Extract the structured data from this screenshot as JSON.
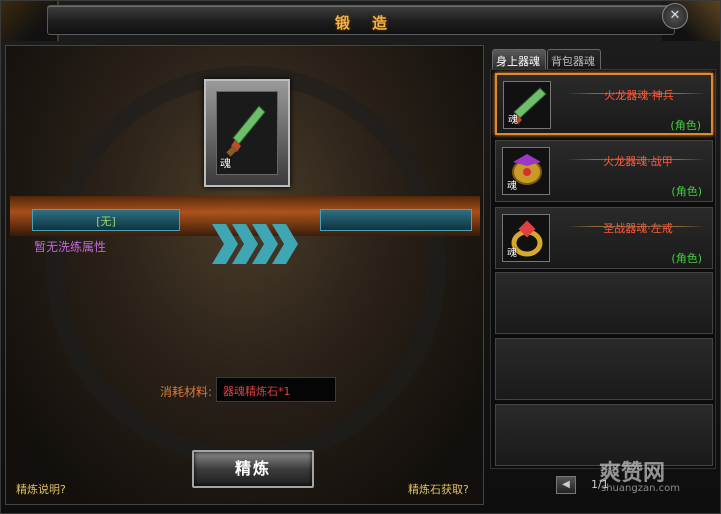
{
  "window": {
    "title": "锻造",
    "close_icon": "close-icon"
  },
  "forge": {
    "item_soul_tag": "魂",
    "left_bar_label": "[无]",
    "right_bar_label": "",
    "no_attribute_text": "暂无洗练属性",
    "material_label": "消耗材料:",
    "material_value": "器魂精炼石*1",
    "refine_button": "精炼",
    "help_link": "精炼说明?",
    "stone_source_link": "精炼石获取?"
  },
  "tabs": [
    {
      "label": "身上器魂",
      "active": true
    },
    {
      "label": "背包器魂",
      "active": false
    }
  ],
  "slots": [
    {
      "name": "火龙器魂·神兵",
      "tag": "(角色)",
      "soul": "魂",
      "icon": "sword-icon",
      "selected": true
    },
    {
      "name": "火龙器魂·战甲",
      "tag": "(角色)",
      "soul": "魂",
      "icon": "helmet-icon",
      "selected": false
    },
    {
      "name": "圣战器魂·左戒",
      "tag": "(角色)",
      "soul": "魂",
      "icon": "ring-icon",
      "selected": false
    },
    {
      "name": "",
      "tag": "",
      "soul": "",
      "icon": "",
      "selected": false
    },
    {
      "name": "",
      "tag": "",
      "soul": "",
      "icon": "",
      "selected": false
    }
  ],
  "pager": {
    "prev_icon": "chevron-left-icon",
    "text": "1/1"
  },
  "watermark": {
    "main": "爽赞网",
    "sub": "shuangzan.com"
  },
  "colors": {
    "title": "#f2b246",
    "item_name": "#ff5a3a",
    "tag": "#40d040",
    "selected_border": "#e08a30",
    "attr_text": "#c46ad6"
  }
}
